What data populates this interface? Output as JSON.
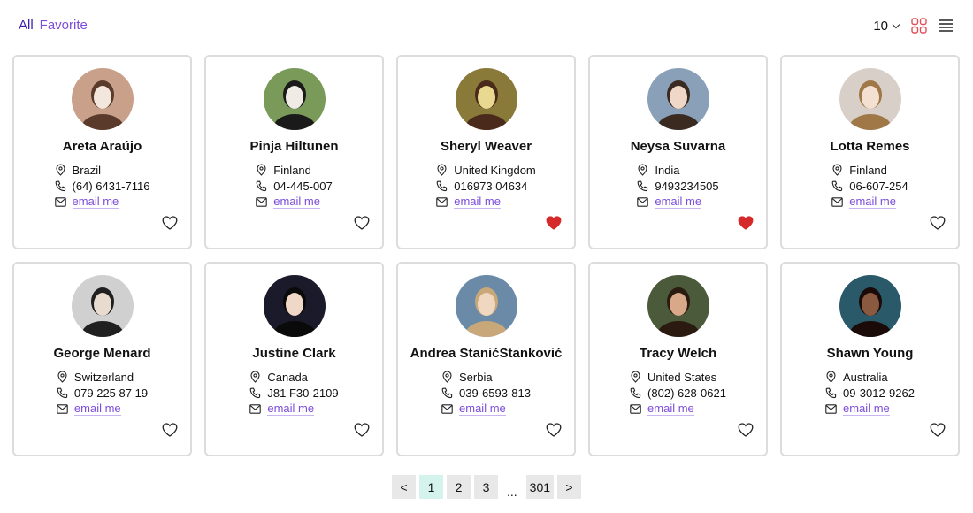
{
  "filters": {
    "all": "All",
    "favorite": "Favorite"
  },
  "controls": {
    "page_size": "10",
    "view_modes": [
      "grid-view-icon",
      "list-view-icon"
    ],
    "active_view": "grid"
  },
  "colors": {
    "accent_purple": "#7c4ddb",
    "active_dark": "#3b1fa6",
    "grid_icon_red": "#e0505a",
    "heart_red": "#d62a2a",
    "card_border": "#dcdcdc",
    "page_current_bg": "#d4f3ec",
    "page_bg": "#e8e8e8"
  },
  "users": [
    {
      "name": "Areta Araújo",
      "country": "Brazil",
      "phone": "(64) 6431-7116",
      "email_label": "email me",
      "favorite": false
    },
    {
      "name": "Pinja Hiltunen",
      "country": "Finland",
      "phone": "04-445-007",
      "email_label": "email me",
      "favorite": false
    },
    {
      "name": "Sheryl Weaver",
      "country": "United Kingdom",
      "phone": "016973 04634",
      "email_label": "email me",
      "favorite": true
    },
    {
      "name": "Neysa Suvarna",
      "country": "India",
      "phone": "9493234505",
      "email_label": "email me",
      "favorite": true
    },
    {
      "name": "Lotta Remes",
      "country": "Finland",
      "phone": "06-607-254",
      "email_label": "email me",
      "favorite": false
    },
    {
      "name": "George Menard",
      "country": "Switzerland",
      "phone": "079 225 87 19",
      "email_label": "email me",
      "favorite": false
    },
    {
      "name": "Justine Clark",
      "country": "Canada",
      "phone": "J81 F30-2109",
      "email_label": "email me",
      "favorite": false
    },
    {
      "name": "Andrea StanićStanković",
      "country": "Serbia",
      "phone": "039-6593-813",
      "email_label": "email me",
      "favorite": false
    },
    {
      "name": "Tracy Welch",
      "country": "United States",
      "phone": "(802) 628-0621",
      "email_label": "email me",
      "favorite": false
    },
    {
      "name": "Shawn Young",
      "country": "Australia",
      "phone": "09-3012-9262",
      "email_label": "email me",
      "favorite": false
    }
  ],
  "pagination": {
    "prev": "<",
    "pages": [
      "1",
      "2",
      "3"
    ],
    "ellipsis": "...",
    "last": "301",
    "next": ">",
    "current": "1"
  }
}
